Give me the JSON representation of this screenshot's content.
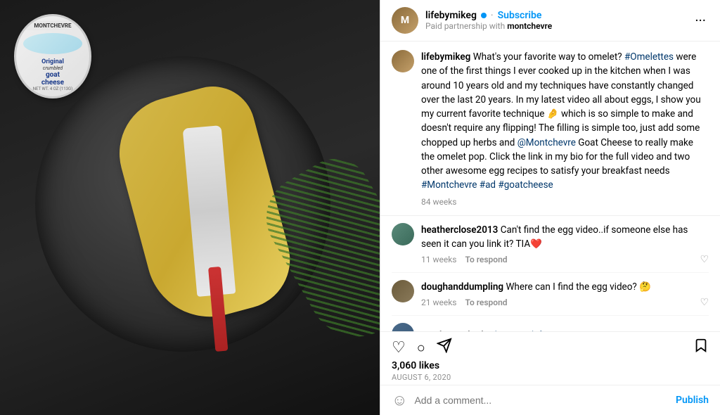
{
  "header": {
    "username": "lifebymikeg",
    "verified": true,
    "verified_dot_color": "#0095f6",
    "subscribe_label": "Subscribe",
    "partnership_prefix": "Paid partnership with",
    "partnership_brand": "montchevre",
    "more_icon": "···"
  },
  "caption": {
    "username": "lifebymikeg",
    "text": " What's your favorite way to omelet? #Omelettes were one of the first things I ever cooked up in the kitchen when I was around 10 years old and my techniques have constantly changed over the last 20 years. In my latest video all about eggs, I show you my current favorite technique 🤌 which is so simple to make and doesn't require any flipping! The filling is simple too, just add some chopped up herbs and @MontchevrGoat Cheese to really make the omelet pop. Click the link in my bio for the full video and two other awesome egg recipes to satisfy your breakfast needs #Montchevre #ad #goatcheese",
    "time": "84 weeks"
  },
  "comments": [
    {
      "id": "heatherclose2013",
      "username": "heatherclose2013",
      "text": "Can't find the egg video..if someone else has seen it can you link it? TIA❤️",
      "time": "11 weeks",
      "respond": "To respond",
      "avatar_class": "avatar-heather"
    },
    {
      "id": "doughanddumpling",
      "username": "doughanddumpling",
      "text": "Where can I find the egg video? 🤔",
      "time": "21 weeks",
      "respond": "To respond",
      "avatar_class": "avatar-dough"
    }
  ],
  "handle_comment": {
    "username": "eastbayrashad",
    "tag": "@kevin_uglyface",
    "avatar_class": "avatar-east"
  },
  "actions": {
    "heart_icon": "♡",
    "comment_icon": "○",
    "share_icon": "▷",
    "bookmark_icon": "⊡",
    "likes_count": "3,060 likes",
    "post_date": "August 6, 2020"
  },
  "comment_input": {
    "emoji_icon": "☺",
    "placeholder": "Add a comment...",
    "publish_label": "Publish"
  },
  "cheese": {
    "brand": "MONTCHEVRE",
    "type": "Original",
    "description1": "crumbled",
    "description2": "goat cheese",
    "weight": "NET WT. 4 OZ (113G)"
  }
}
